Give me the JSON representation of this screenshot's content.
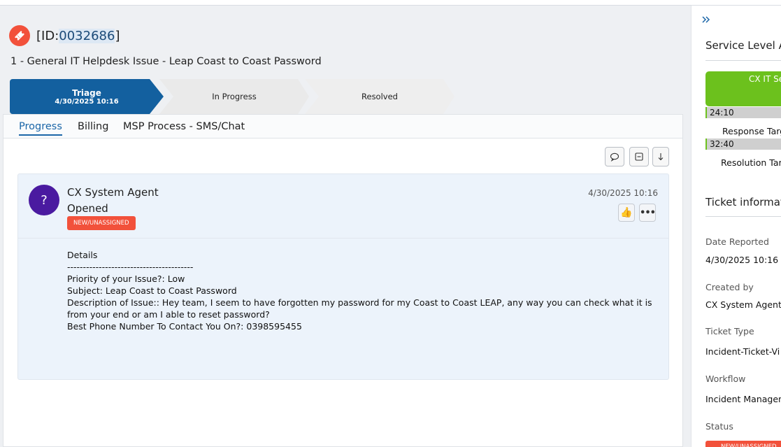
{
  "ticket": {
    "id_prefix": "[ID:",
    "id_number": "0032686",
    "id_suffix": "]",
    "title": "1 - General IT Helpdesk Issue - Leap Coast to Coast Password"
  },
  "stages": [
    {
      "label": "Triage",
      "date": "4/30/2025 10:16",
      "active": true
    },
    {
      "label": "In Progress",
      "date": "",
      "active": false
    },
    {
      "label": "Resolved",
      "date": "",
      "active": false
    }
  ],
  "tabs": [
    "Progress",
    "Billing",
    "MSP Process - SMS/Chat"
  ],
  "active_tab": "Progress",
  "entry": {
    "avatar_text": "?",
    "author": "CX System Agent",
    "action": "Opened",
    "status_badge": "NEW/UNASSIGNED",
    "date": "4/30/2025 10:16",
    "details_lines": [
      "Details",
      "----------------------------------------",
      "Priority of your Issue?: Low",
      "Subject: Leap Coast to Coast Password",
      "Description of Issue:: Hey team, I seem to have forgotten my password for my Coast to Coast LEAP, any way you can check what it is from your end or am I able to reset password?",
      "Best Phone Number To Contact You On?: 0398595455"
    ]
  },
  "sidebar": {
    "collapse_icon": "double-chevron-right-icon",
    "sla_heading": "Service Level A",
    "sla_box_label": "CX IT Se",
    "response_time": "24:10",
    "response_label": "Response Targ",
    "resolution_time": "32:40",
    "resolution_label": "Resolution Targ",
    "info_heading": "Ticket informat",
    "fields": [
      {
        "label": "Date Reported",
        "value": "4/30/2025 10:16"
      },
      {
        "label": "Created by",
        "value": "CX System Agent"
      },
      {
        "label": "Ticket Type",
        "value": "Incident-Ticket-Vi"
      },
      {
        "label": "Workflow",
        "value": "Incident Managen"
      },
      {
        "label": "Status",
        "value": "NEW/UNASSIGNED"
      }
    ]
  },
  "colors": {
    "accent": "#13609f",
    "ticket_icon": "#f2513b",
    "badge": "#f2513b",
    "sla_green": "#6cc11d",
    "avatar": "#4a1aa0"
  }
}
